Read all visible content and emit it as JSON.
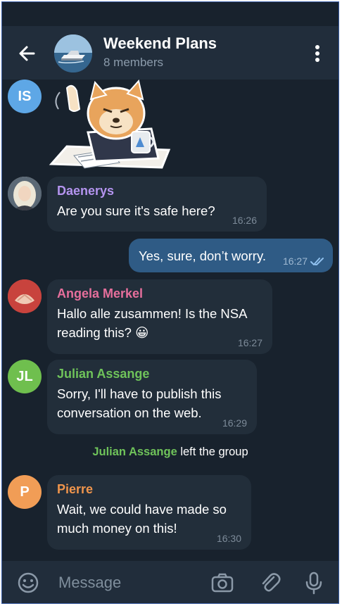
{
  "header": {
    "title": "Weekend Plans",
    "subtitle": "8 members"
  },
  "messages": [
    {
      "sender_initials": "IS",
      "type": "sticker",
      "avatar_color": "#5ea7e6"
    },
    {
      "sender": "Daenerys",
      "name_color": "#b494ef",
      "text": "Are you sure it's safe here?",
      "time": "16:26"
    },
    {
      "outgoing": true,
      "text": "Yes, sure, don’t worry.",
      "time": "16:27"
    },
    {
      "sender": "Angela Merkel",
      "name_color": "#e66f9c",
      "text_line1": "Hallo alle zusammen! Is the NSA",
      "text_line2": "reading this? 😀",
      "time": "16:27"
    },
    {
      "sender_initials": "JL",
      "sender": "Julian Assange",
      "name_color": "#6fc35a",
      "avatar_color": "#6fbf4e",
      "text_line1": "Sorry, I'll have to publish this",
      "text_line2": "conversation on the web.",
      "time": "16:29"
    },
    {
      "sender_initials": "P",
      "sender": "Pierre",
      "name_color": "#f0954c",
      "avatar_color": "#f19d56",
      "text_line1": "Wait, we could have made so",
      "text_line2": "much money on this!",
      "time": "16:30"
    }
  ],
  "service_message": {
    "actor": "Julian Assange",
    "action": "left the group"
  },
  "input": {
    "placeholder": "Message"
  },
  "icons": [
    "back-arrow-icon",
    "more-vert-icon",
    "emoji-icon",
    "camera-icon",
    "attach-icon",
    "microphone-icon",
    "double-check-icon"
  ]
}
